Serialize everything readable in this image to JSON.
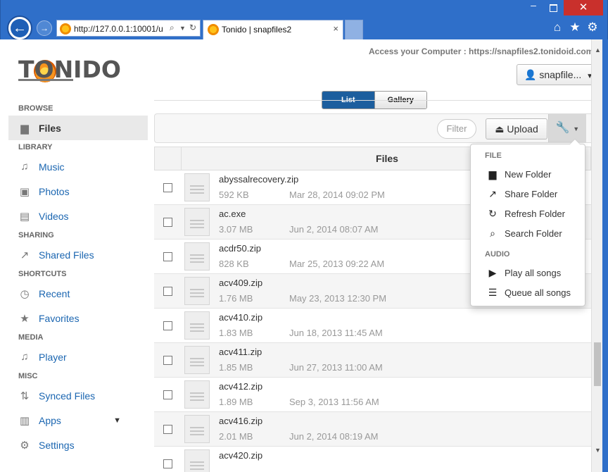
{
  "browser": {
    "address_url": "http://127.0.0.1:10001/u",
    "tab_title": "Tonido | snapfiles2",
    "tab_close": "×",
    "back_icon": "arrow-left",
    "forward_icon": "arrow-right"
  },
  "header": {
    "logo_text": "TONIDO",
    "access_text": "Access your Computer : https://snapfiles2.tonidoid.com",
    "user_button": "snapfile..."
  },
  "view_toggle": {
    "list": "List",
    "gallery": "Gallery",
    "selected": "List"
  },
  "toolbar": {
    "filter_placeholder": "Filter",
    "upload_label": "Upload"
  },
  "sidebar": {
    "sections": [
      {
        "title": "BROWSE",
        "items": [
          {
            "label": "Files",
            "icon": "folder-icon",
            "active": true
          }
        ]
      },
      {
        "title": "LIBRARY",
        "items": [
          {
            "label": "Music",
            "icon": "music-icon"
          },
          {
            "label": "Photos",
            "icon": "photo-icon"
          },
          {
            "label": "Videos",
            "icon": "film-icon"
          }
        ]
      },
      {
        "title": "SHARING",
        "items": [
          {
            "label": "Shared Files",
            "icon": "share-icon"
          }
        ]
      },
      {
        "title": "SHORTCUTS",
        "items": [
          {
            "label": "Recent",
            "icon": "clock-icon"
          },
          {
            "label": "Favorites",
            "icon": "star-icon"
          }
        ]
      },
      {
        "title": "MEDIA",
        "items": [
          {
            "label": "Player",
            "icon": "music-icon"
          }
        ]
      },
      {
        "title": "MISC",
        "items": [
          {
            "label": "Synced Files",
            "icon": "sync-icon"
          },
          {
            "label": "Apps",
            "icon": "chart-icon"
          },
          {
            "label": "Settings",
            "icon": "gear-icon"
          }
        ]
      }
    ]
  },
  "table": {
    "header": "Files",
    "rows": [
      {
        "name": "abyssalrecovery.zip",
        "size": "592 KB",
        "date": "Mar 28, 2014 09:02 PM"
      },
      {
        "name": "ac.exe",
        "size": "3.07 MB",
        "date": "Jun 2, 2014 08:07 AM"
      },
      {
        "name": "acdr50.zip",
        "size": "828 KB",
        "date": "Mar 25, 2013 09:22 AM"
      },
      {
        "name": "acv409.zip",
        "size": "1.76 MB",
        "date": "May 23, 2013 12:30 PM"
      },
      {
        "name": "acv410.zip",
        "size": "1.83 MB",
        "date": "Jun 18, 2013 11:45 AM"
      },
      {
        "name": "acv411.zip",
        "size": "1.85 MB",
        "date": "Jun 27, 2013 11:00 AM"
      },
      {
        "name": "acv412.zip",
        "size": "1.89 MB",
        "date": "Sep 3, 2013 11:56 AM"
      },
      {
        "name": "acv416.zip",
        "size": "2.01 MB",
        "date": "Jun 2, 2014 08:19 AM"
      },
      {
        "name": "acv420.zip",
        "size": "",
        "date": ""
      }
    ]
  },
  "dropdown": {
    "sections": [
      {
        "title": "FILE",
        "items": [
          {
            "label": "New Folder",
            "icon": "folder-icon"
          },
          {
            "label": "Share Folder",
            "icon": "external-link-icon"
          },
          {
            "label": "Refresh Folder",
            "icon": "refresh-icon"
          },
          {
            "label": "Search Folder",
            "icon": "search-icon"
          }
        ]
      },
      {
        "title": "AUDIO",
        "items": [
          {
            "label": "Play all songs",
            "icon": "play-icon"
          },
          {
            "label": "Queue all songs",
            "icon": "list-icon"
          }
        ]
      }
    ]
  }
}
